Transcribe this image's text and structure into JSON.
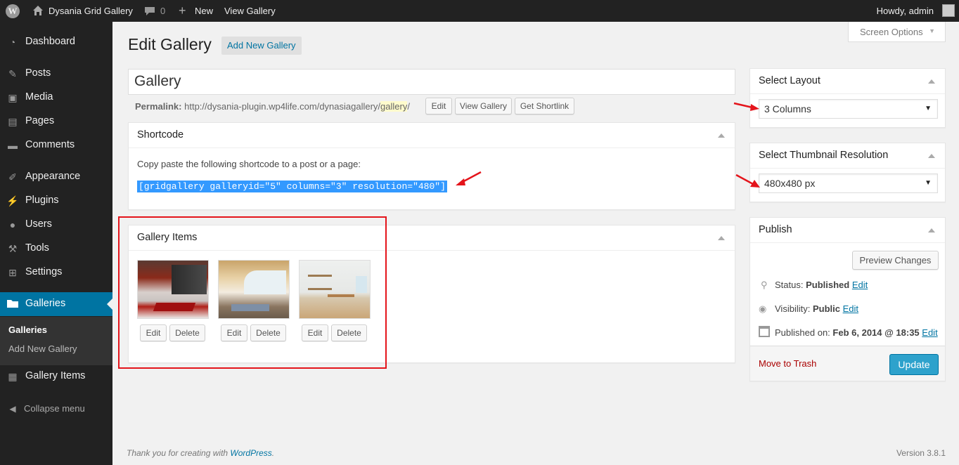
{
  "adminbar": {
    "wp_logo": "wordpress-logo",
    "site_name": "Dysania Grid Gallery",
    "comments_count": "0",
    "new_label": "New",
    "view_gallery_label": "View Gallery",
    "howdy": "Howdy, admin"
  },
  "sidebar": {
    "items": [
      {
        "label": "Dashboard",
        "icon": "dashboard-icon"
      },
      {
        "label": "Posts",
        "icon": "pin-icon"
      },
      {
        "label": "Media",
        "icon": "media-icon"
      },
      {
        "label": "Pages",
        "icon": "pages-icon"
      },
      {
        "label": "Comments",
        "icon": "comment-icon"
      },
      {
        "label": "Appearance",
        "icon": "brush-icon"
      },
      {
        "label": "Plugins",
        "icon": "plugin-icon"
      },
      {
        "label": "Users",
        "icon": "user-icon"
      },
      {
        "label": "Tools",
        "icon": "wrench-icon"
      },
      {
        "label": "Settings",
        "icon": "settings-icon"
      },
      {
        "label": "Galleries",
        "icon": "folder-icon"
      },
      {
        "label": "Gallery Items",
        "icon": "gallery-icon"
      }
    ],
    "submenu": [
      "Galleries",
      "Add New Gallery"
    ],
    "collapse": "Collapse menu"
  },
  "header": {
    "title": "Edit Gallery",
    "add_new": "Add New Gallery",
    "screen_options": "Screen Options"
  },
  "post": {
    "title_value": "Gallery",
    "permalink_label": "Permalink:",
    "permalink_base": "http://dysania-plugin.wp4life.com/dynasiagallery/",
    "permalink_slug": "gallery",
    "permalink_end": "/",
    "edit_btn": "Edit",
    "view_btn": "View Gallery",
    "shortlink_btn": "Get Shortlink"
  },
  "shortcode_box": {
    "title": "Shortcode",
    "instruction": "Copy paste the following shortcode to a post or a page:",
    "code": "[gridgallery galleryid=\"5\" columns=\"3\" resolution=\"480\"]"
  },
  "gallery_items": {
    "title": "Gallery Items",
    "edit_label": "Edit",
    "delete_label": "Delete",
    "items": [
      {
        "image": "red-living-room-photo"
      },
      {
        "image": "curved-wood-room-photo"
      },
      {
        "image": "white-office-photo"
      }
    ]
  },
  "layout_box": {
    "title": "Select Layout",
    "value": "3 Columns"
  },
  "thumb_box": {
    "title": "Select Thumbnail Resolution",
    "value": "480x480 px"
  },
  "publish": {
    "title": "Publish",
    "preview": "Preview Changes",
    "status_label": "Status:",
    "status_value": "Published",
    "visibility_label": "Visibility:",
    "visibility_value": "Public",
    "published_label": "Published on:",
    "published_value": "Feb 6, 2014 @ 18:35",
    "edit": "Edit",
    "trash": "Move to Trash",
    "update": "Update"
  },
  "footer": {
    "thanks": "Thank you for creating with",
    "wordpress": "WordPress",
    "period": ".",
    "version": "Version 3.8.1"
  },
  "colors": {
    "accent": "#0074a2",
    "update_button": "#2ea2cc",
    "trash": "#a00",
    "highlight_box": "#e4141b"
  }
}
